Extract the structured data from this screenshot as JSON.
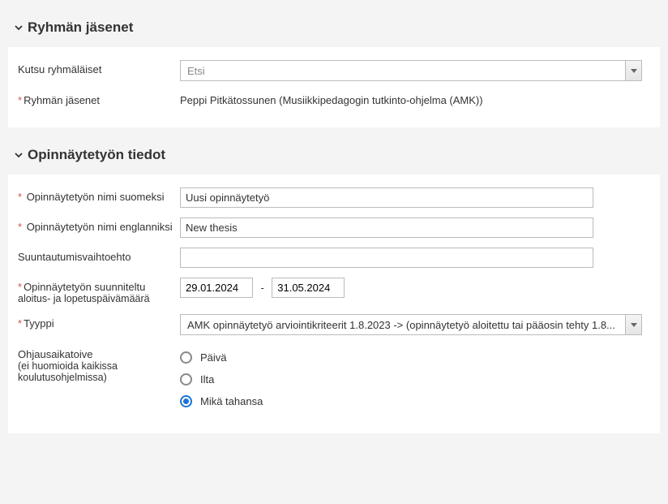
{
  "panel1": {
    "title": "Ryhmän jäsenet",
    "invite_label": "Kutsu ryhmäläiset",
    "invite_placeholder": "Etsi",
    "members_label": "Ryhmän jäsenet",
    "members_value": "Peppi Pitkätossunen (Musiikkipedagogin tutkinto-ohjelma (AMK))"
  },
  "panel2": {
    "title": "Opinnäytetyön tiedot",
    "name_fi_label": "Opinnäytetyön nimi suomeksi",
    "name_fi_value": "Uusi opinnäytetyö",
    "name_en_label": "Opinnäytetyön nimi englanniksi",
    "name_en_value": "New thesis",
    "orientation_label": "Suuntautumisvaihtoehto",
    "orientation_value": "",
    "dates_label_1": "Opinnäytetyön suunniteltu",
    "dates_label_2": "aloitus- ja lopetuspäivämäärä",
    "date_start": "29.01.2024",
    "date_sep": "-",
    "date_end": "31.05.2024",
    "type_label": "Tyyppi",
    "type_value": "AMK opinnäytetyö arviointikriteerit 1.8.2023 -> (opinnäytetyö aloitettu tai pääosin tehty 1.8...",
    "guidance_label_1": "Ohjausaikatoive",
    "guidance_label_2": "(ei huomioida kaikissa",
    "guidance_label_3": "koulutusohjelmissa)",
    "radio_day": "Päivä",
    "radio_evening": "Ilta",
    "radio_any": "Mikä tahansa"
  }
}
